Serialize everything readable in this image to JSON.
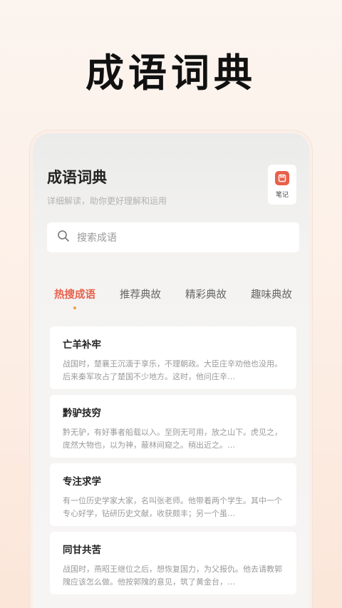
{
  "promo": {
    "title": "成语词典"
  },
  "app": {
    "title": "成语词典",
    "subtitle": "详细解读，助你更好理解和运用"
  },
  "note_button": {
    "label": "笔记",
    "icon": "notebook-icon",
    "color": "#e8604a"
  },
  "search": {
    "placeholder": "搜索成语",
    "icon": "search-icon"
  },
  "tabs": [
    {
      "label": "热搜成语",
      "active": true
    },
    {
      "label": "推荐典故",
      "active": false
    },
    {
      "label": "精彩典故",
      "active": false
    },
    {
      "label": "趣味典故",
      "active": false
    }
  ],
  "cards": [
    {
      "title": "亡羊补牢",
      "text": "战国时，楚襄王沉湎于享乐，不理朝政。大臣庄辛劝他也没用。后来秦军攻占了楚国不少地方。这时，他问庄辛…"
    },
    {
      "title": "黔驴技穷",
      "text": "黔无驴，有好事者船载以入。至则无可用，放之山下。虎见之，庞然大物也，以为神，蔽林间窥之。稍出近之。…"
    },
    {
      "title": "专注求学",
      "text": "有一位历史学家大家，名叫张老师。他带着两个学生。其中一个专心好学，钻研历史文献，收获颇丰；另一个虽…"
    },
    {
      "title": "同甘共苦",
      "text": "战国时，燕昭王继位之后，想恢复国力，为父报仇。他去请教郭隗应该怎么做。他按郭隗的意见，筑了黄金台，…"
    }
  ],
  "colors": {
    "accent": "#e8604a",
    "tab_dot": "#e8a04a"
  }
}
